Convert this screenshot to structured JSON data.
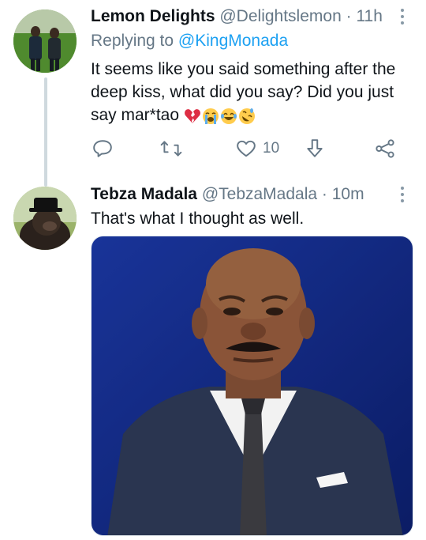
{
  "tweet1": {
    "display_name": "Lemon Delights",
    "handle": "@Delightslemon",
    "separator": "·",
    "time": "11h",
    "replying_prefix": "Replying to",
    "replying_to": "@KingMonada",
    "text": "It seems like you said something after the deep kiss, what did you say? Did you just say mar*tao",
    "emojis": [
      "broken-heart-icon",
      "loudly-crying-face-icon",
      "tears-of-joy-face-icon",
      "rolling-on-floor-laughing-icon"
    ],
    "actions": {
      "reply_icon": "reply-icon",
      "retweet_icon": "retweet-icon",
      "like_icon": "heart-icon",
      "like_count": "10",
      "share_icon": "share-arrow-icon",
      "network_icon": "share-network-icon"
    }
  },
  "tweet2": {
    "display_name": "Tebza Madala",
    "handle": "@TebzaMadala",
    "separator": "·",
    "time": "10m",
    "text": "That's what I thought as well.",
    "media_icon": "photo"
  },
  "colors": {
    "text_primary": "#0f1419",
    "text_secondary": "#657786",
    "link": "#1da1f2",
    "thread_line": "#cfd9de",
    "icon": "#657786"
  }
}
